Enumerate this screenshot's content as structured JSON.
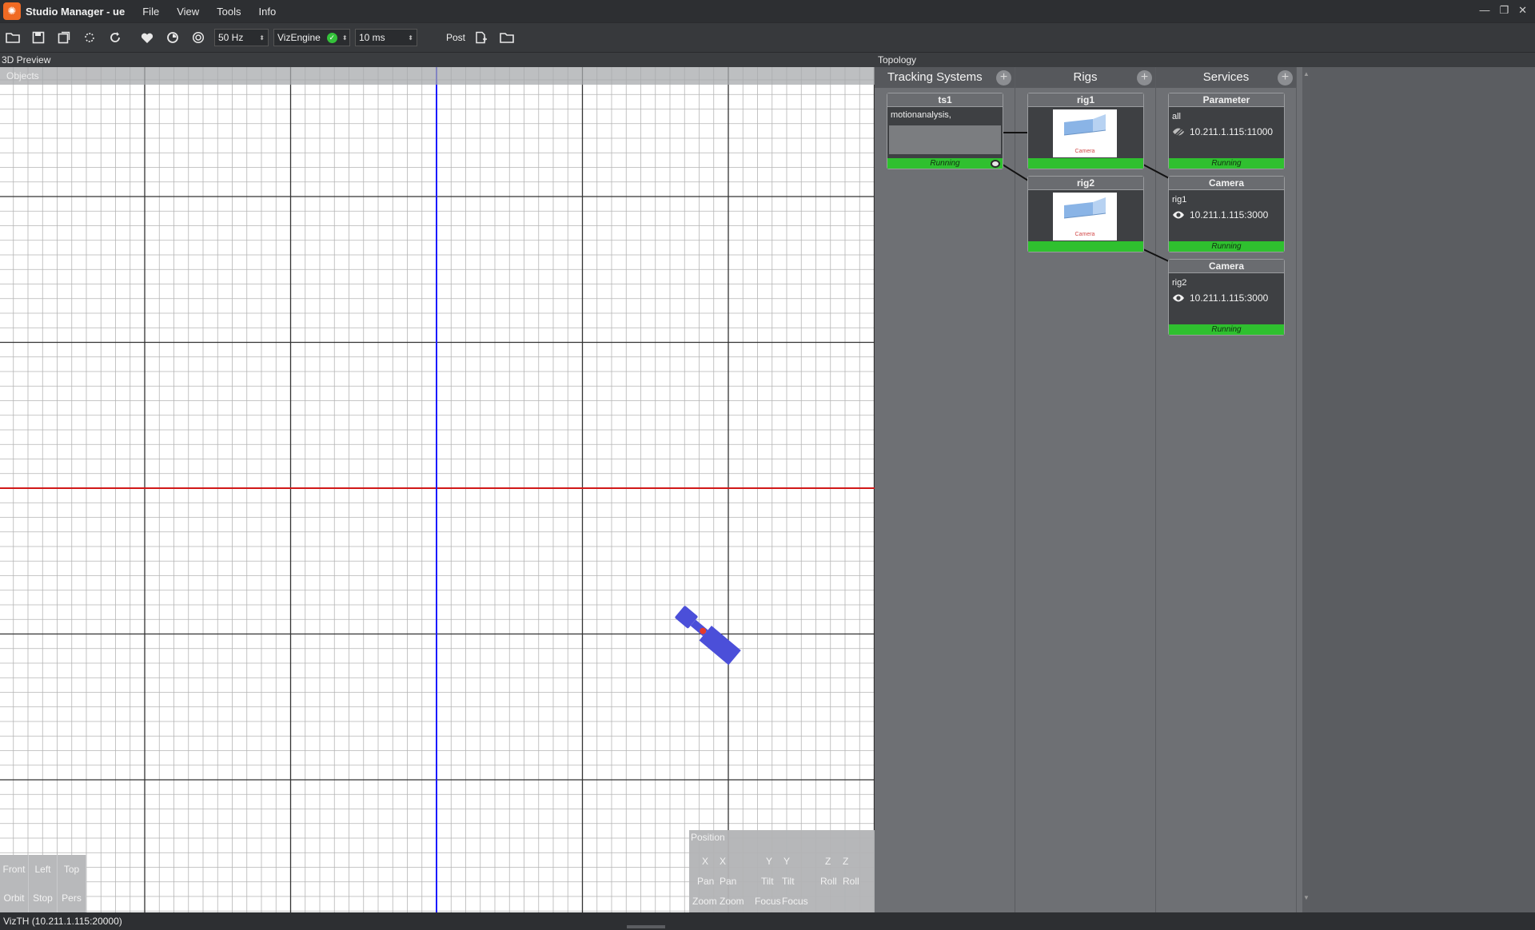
{
  "window": {
    "title": "Studio Manager - ue",
    "minimize": "—",
    "restore": "❐",
    "close": "✕"
  },
  "menu": [
    "File",
    "View",
    "Tools",
    "Info"
  ],
  "toolbar": {
    "rate": "50 Hz",
    "engine": "VizEngine",
    "delay": "10 ms",
    "post_label": "Post"
  },
  "preview": {
    "title": "3D Preview",
    "objects_label": "Objects",
    "view_buttons_row1": [
      "Front",
      "Left",
      "Top"
    ],
    "view_buttons_row2": [
      "Orbit",
      "Stop",
      "Pers"
    ],
    "position": {
      "title": "Position",
      "row1": [
        "X",
        "X",
        "Y",
        "Y",
        "Z",
        "Z"
      ],
      "row2": [
        "Pan",
        "Pan",
        "Tilt",
        "Tilt",
        "Roll",
        "Roll"
      ],
      "row3": [
        "Zoom",
        "Zoom",
        "Focus",
        "Focus"
      ]
    }
  },
  "topology": {
    "title": "Topology",
    "columns": {
      "tracking": "Tracking Systems",
      "rigs": "Rigs",
      "services": "Services"
    },
    "ts1": {
      "name": "ts1",
      "type": "motionanalysis,",
      "status": "Running"
    },
    "rig1": {
      "name": "rig1",
      "thumb": "Camera"
    },
    "rig2": {
      "name": "rig2",
      "thumb": "Camera"
    },
    "param": {
      "name": "Parameter",
      "sub": "all",
      "ip": "10.211.1.115:11000",
      "status": "Running"
    },
    "cam1": {
      "name": "Camera",
      "sub": "rig1",
      "ip": "10.211.1.115:3000",
      "status": "Running"
    },
    "cam2": {
      "name": "Camera",
      "sub": "rig2",
      "ip": "10.211.1.115:3000",
      "status": "Running"
    }
  },
  "statusbar": {
    "text": "VizTH (10.211.1.115:20000)"
  },
  "colors": {
    "axis_x": "#d01818",
    "axis_y": "#1a1aff",
    "running": "#2fc02f",
    "camera_body": "#4b4fd9",
    "accent": "#f06a23"
  }
}
